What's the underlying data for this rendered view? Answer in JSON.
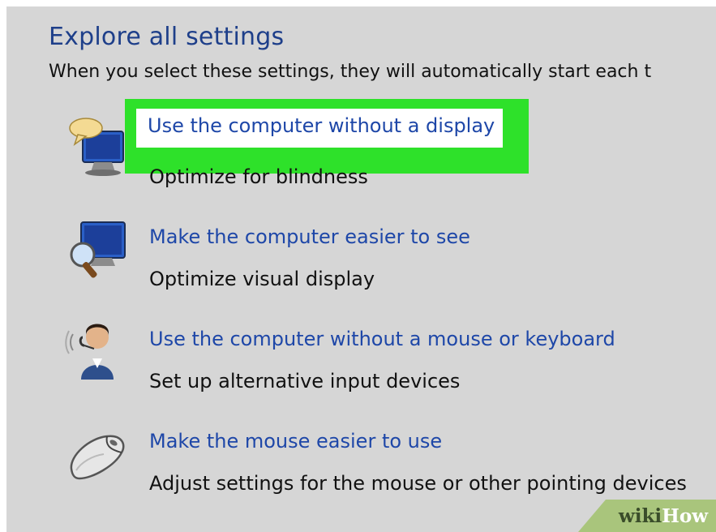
{
  "page": {
    "heading": "Explore all settings",
    "subtitle": "When you select these settings, they will automatically start each t"
  },
  "items": [
    {
      "link": "Use the computer without a display",
      "desc": "Optimize for blindness",
      "icon": "speech-bubble-monitor-icon"
    },
    {
      "link": "Make the computer easier to see",
      "desc": "Optimize visual display",
      "icon": "magnifier-monitor-icon"
    },
    {
      "link": "Use the computer without a mouse or keyboard",
      "desc": "Set up alternative input devices",
      "icon": "headset-person-icon"
    },
    {
      "link": "Make the mouse easier to use",
      "desc": "Adjust settings for the mouse or other pointing devices",
      "icon": "mouse-icon"
    }
  ],
  "highlight": {
    "color": "#2ee12a"
  },
  "watermark": {
    "wiki": "wiki",
    "how": "How"
  },
  "colors": {
    "background": "#d6d6d6",
    "heading": "#1e3f8a",
    "link": "#1e47a8",
    "text": "#111111"
  }
}
